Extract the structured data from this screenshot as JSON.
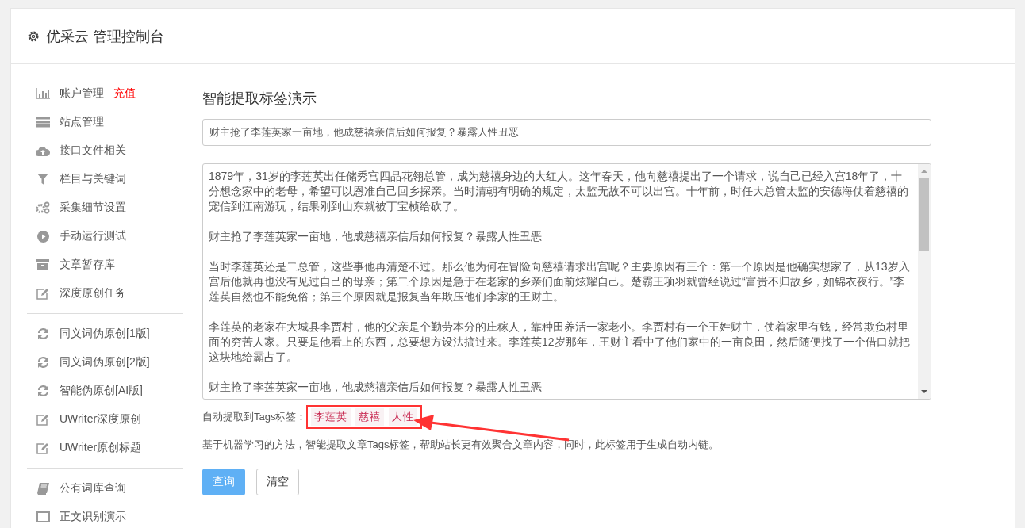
{
  "header": {
    "title": "优采云 管理控制台"
  },
  "sidebar": {
    "groups": [
      {
        "items": [
          {
            "label": "账户管理",
            "badge": "充值",
            "kind": "chart"
          },
          {
            "label": "站点管理",
            "kind": "server"
          },
          {
            "label": "接口文件相关",
            "kind": "cloud"
          },
          {
            "label": "栏目与关键词",
            "kind": "filter"
          },
          {
            "label": "采集细节设置",
            "kind": "gears"
          },
          {
            "label": "手动运行测试",
            "kind": "play"
          },
          {
            "label": "文章暂存库",
            "kind": "archive"
          },
          {
            "label": "深度原创任务",
            "kind": "edit"
          }
        ]
      },
      {
        "items": [
          {
            "label": "同义词伪原创[1版]",
            "kind": "refresh"
          },
          {
            "label": "同义词伪原创[2版]",
            "kind": "refresh"
          },
          {
            "label": "智能伪原创[AI版]",
            "kind": "refresh"
          },
          {
            "label": "UWriter深度原创",
            "kind": "edit"
          },
          {
            "label": "UWriter原创标题",
            "kind": "edit"
          }
        ]
      },
      {
        "items": [
          {
            "label": "公有词库查询",
            "kind": "book"
          },
          {
            "label": "正文识别演示",
            "kind": "window"
          }
        ]
      }
    ]
  },
  "panel": {
    "title": "智能提取标签演示",
    "title_field": {
      "value": "财主抢了李莲英家一亩地，他成慈禧亲信后如何报复？暴露人性丑恶"
    },
    "article": [
      "1879年，31岁的李莲英出任储秀宫四品花翎总管，成为慈禧身边的大红人。这年春天，他向慈禧提出了一个请求，说自己已经入宫18年了，十分想念家中的老母，希望可以恩准自己回乡探亲。当时清朝有明确的规定，太监无故不可以出宫。十年前，时任大总管太监的安德海仗着慈禧的宠信到江南游玩，结果刚到山东就被丁宝桢给砍了。",
      "财主抢了李莲英家一亩地，他成慈禧亲信后如何报复？暴露人性丑恶",
      "当时李莲英还是二总管，这些事他再清楚不过。那么他为何在冒险向慈禧请求出宫呢？主要原因有三个：第一个原因是他确实想家了，从13岁入宫后他就再也没有见过自己的母亲；第二个原因是急于在老家的乡亲们面前炫耀自己。楚霸王项羽就曾经说过“富贵不归故乡，如锦衣夜行。”李莲英自然也不能免俗；第三个原因就是报复当年欺压他们李家的王财主。",
      "李莲英的老家在大城县李贾村，他的父亲是个勤劳本分的庄稼人，靠种田养活一家老小。李贾村有一个王姓财主，仗着家里有钱，经常欺负村里面的穷苦人家。只要是他看上的东西，总要想方设法搞过来。李莲英12岁那年，王财主看中了他们家中的一亩良田，然后随便找了一个借口就把这块地给霸占了。",
      "财主抢了李莲英家一亩地，他成慈禧亲信后如何报复？暴露人性丑恶"
    ],
    "tags_label": "自动提取到Tags标签：",
    "tags": [
      "李莲英",
      "慈禧",
      "人性"
    ],
    "description": "基于机器学习的方法，智能提取文章Tags标签，帮助站长更有效聚合文章内容，同时，此标签用于生成自动内链。",
    "buttons": [
      {
        "label": "查询",
        "kind": "primary"
      },
      {
        "label": "清空",
        "kind": "default"
      }
    ]
  }
}
